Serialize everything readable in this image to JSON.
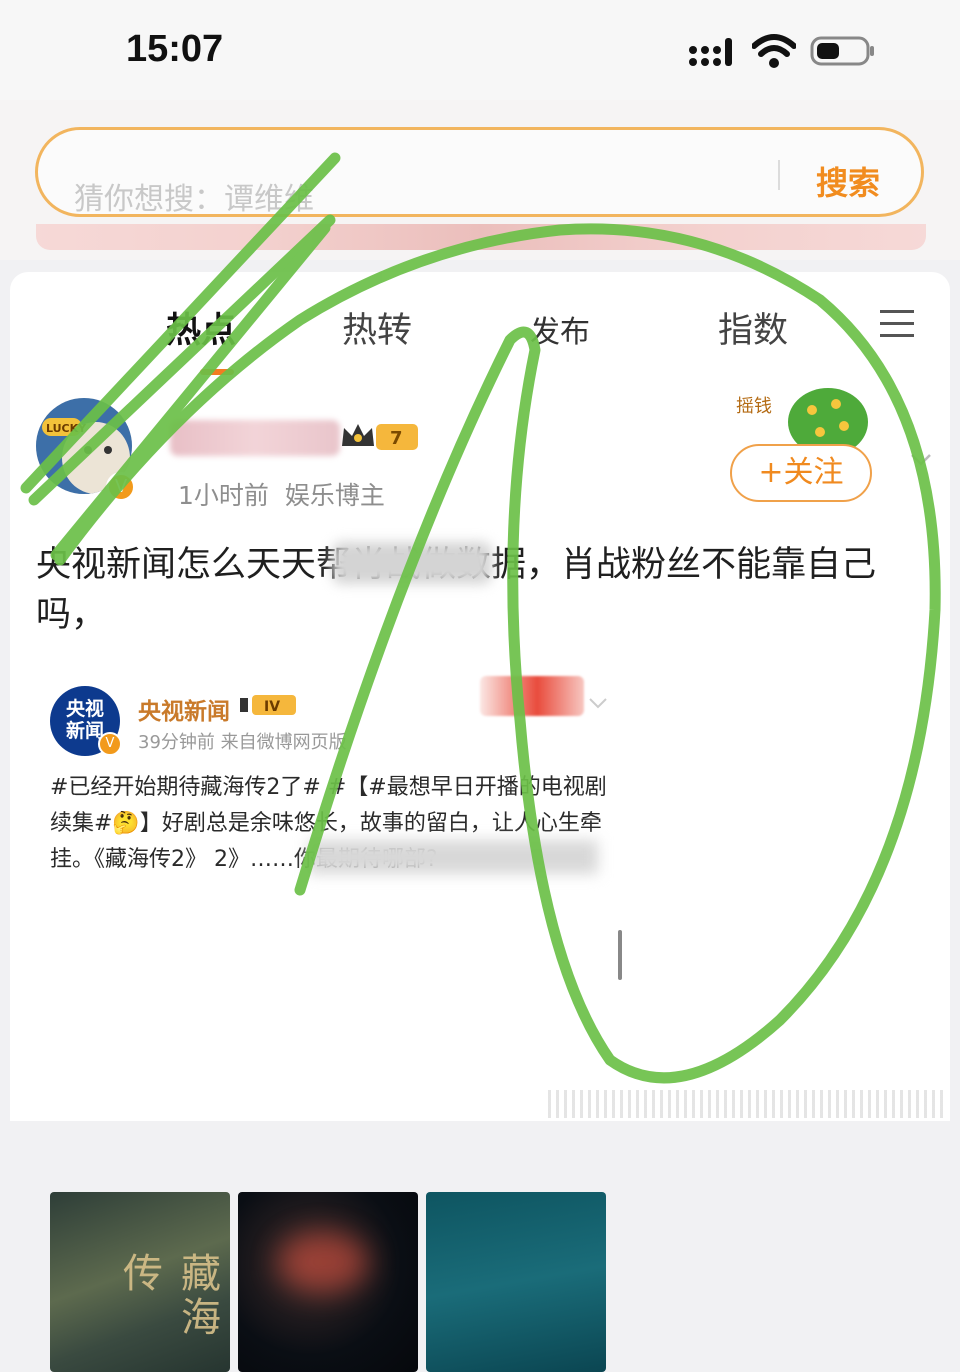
{
  "status_bar": {
    "time": "15:07"
  },
  "search": {
    "placeholder": "猜你想搜：谭维维",
    "button_label": "搜索"
  },
  "tabs": [
    {
      "label": "热点",
      "active": true
    },
    {
      "label": "热转",
      "active": false
    },
    {
      "label": "发布",
      "active": false
    },
    {
      "label": "指数",
      "active": false
    }
  ],
  "post": {
    "time_ago": "1小时前",
    "category": "娱乐博主",
    "follow_label": "+关注",
    "avatar_badge": "LUCKY",
    "level_badge": "7",
    "decoration_label": "摇钱",
    "text": "央视新闻怎么天天帮肖战做数据，肖战粉丝不能靠自己吗，"
  },
  "repost": {
    "logo_text_top": "央视",
    "logo_text_bottom": "新闻",
    "name": "央视新闻",
    "badge": "IV",
    "meta": "39分钟前 来自微博网页版",
    "text": "#已经开始期待藏海传2了# #【#最想早日开播的电视剧续集#🤔】好剧总是余味悠长，故事的留白，让人心生牵挂。《藏海传2》 2》……你最期待哪部?",
    "thumb_title": "藏海传"
  },
  "colors": {
    "accent_orange": "#f18c1f",
    "search_border": "#f2b55e",
    "scribble_green": "#6bc048",
    "cctv_blue": "#0d3a8e"
  },
  "icons": [
    "signal-icon",
    "wifi-icon",
    "battery-icon",
    "menu-icon",
    "verified-icon",
    "crown-icon",
    "chevron-down-icon"
  ]
}
